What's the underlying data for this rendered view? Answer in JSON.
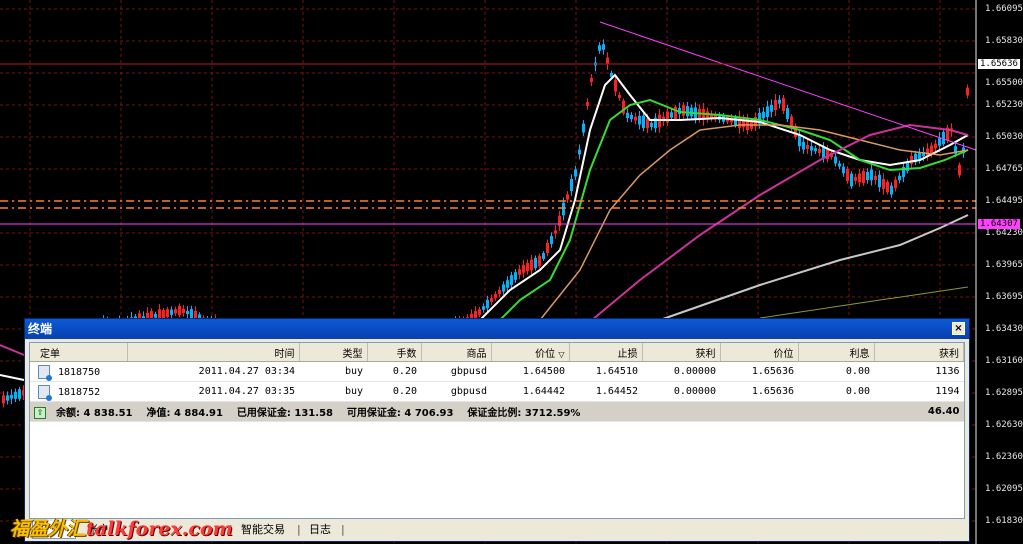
{
  "chart": {
    "symbol": "GBPUSD",
    "price_axis": [
      "1.66095",
      "1.65830",
      "1.65636",
      "1.65500",
      "1.65230",
      "1.65030",
      "1.64765",
      "1.64495",
      "1.64230",
      "1.63965",
      "1.63695",
      "1.63430",
      "1.63160",
      "1.62895",
      "1.62630",
      "1.62360",
      "1.62095",
      "1.61830"
    ],
    "current_price_tag": "1.65636",
    "line_price_tag": "1.64307",
    "colors": {
      "grid": "#7a1414",
      "bull_candle": "#00b4ff",
      "bear_candle": "#ff2020",
      "ma_white": "#ffffff",
      "ma_green": "#33dd33",
      "ma_tan": "#d89a60",
      "ma_magenta": "#cc3399",
      "ma_silver": "#c8c8c8",
      "ma_olive": "#8a9a30",
      "trendline": "#ff40ff",
      "dashed_level": "#ff8030"
    }
  },
  "terminal": {
    "title": "终端",
    "close_glyph": "×",
    "columns": [
      "定单",
      "时间",
      "类型",
      "手数",
      "商品",
      "价位",
      "止损",
      "获利",
      "价位",
      "利息",
      "获利"
    ],
    "sort_marker": "▽",
    "orders": [
      {
        "ticket": "1818750",
        "time": "2011.04.27 03:34",
        "type": "buy",
        "lots": "0.20",
        "symbol": "gbpusd",
        "open_price": "1.64500",
        "stop_loss": "1.64510",
        "take_profit": "0.00000",
        "price": "1.65636",
        "swap": "0.00",
        "profit": "1136"
      },
      {
        "ticket": "1818752",
        "time": "2011.04.27 03:35",
        "type": "buy",
        "lots": "0.20",
        "symbol": "gbpusd",
        "open_price": "1.64442",
        "stop_loss": "1.64452",
        "take_profit": "0.00000",
        "price": "1.65636",
        "swap": "0.00",
        "profit": "1194"
      }
    ],
    "summary": {
      "balance_label": "余额:",
      "balance": "4 838.51",
      "equity_label": "净值:",
      "equity": "4 884.91",
      "margin_label": "已用保证金:",
      "margin": "131.58",
      "free_margin_label": "可用保证金:",
      "free_margin": "4 706.93",
      "margin_level_label": "保证金比例:",
      "margin_level": "3712.59%",
      "total_profit": "46.40"
    },
    "tabs": [
      "账户",
      "智能交易",
      "日志"
    ]
  },
  "watermark": {
    "cn": "福盈外汇",
    "en": "talkforex.com"
  }
}
